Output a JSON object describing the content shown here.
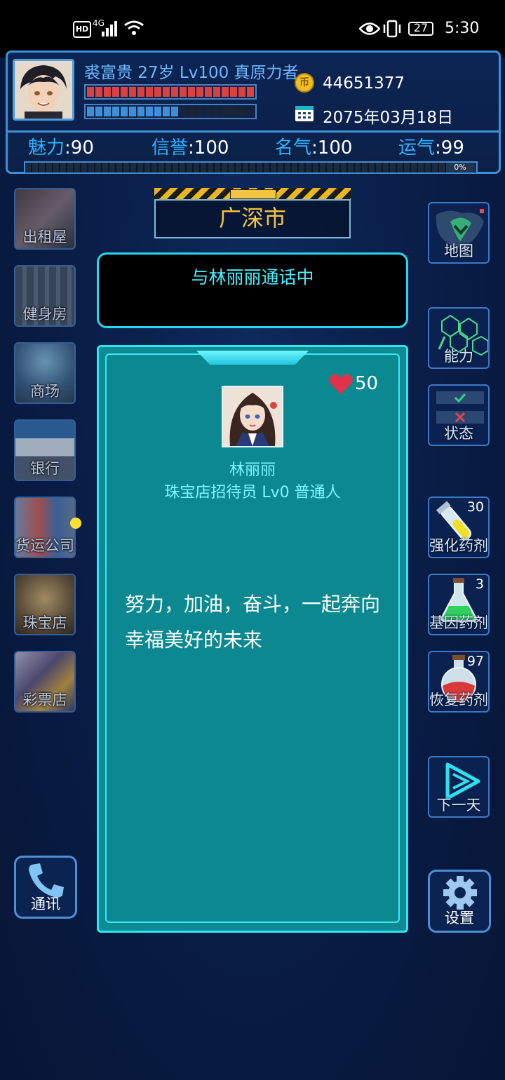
{
  "status_bar": {
    "hd": "HD",
    "net": "4G",
    "battery": "27",
    "time": "5:30"
  },
  "player": {
    "info": "裘富贵 27岁 Lv100 真原力者",
    "coins": "44651377",
    "date": "2075年03月18日",
    "hp_fill": 1.0,
    "mp_fill": 0.55,
    "exp_percent": "0%",
    "colors": {
      "hp": "#d9423f",
      "mp": "#3f8fd6",
      "label": "#31b3ff"
    }
  },
  "stats": [
    {
      "label": "魅力",
      "value": "90"
    },
    {
      "label": "信誉",
      "value": "100"
    },
    {
      "label": "名气",
      "value": "100"
    },
    {
      "label": "运气",
      "value": "99"
    }
  ],
  "left_nav": [
    {
      "label": "出租屋"
    },
    {
      "label": "健身房"
    },
    {
      "label": "商场"
    },
    {
      "label": "银行"
    },
    {
      "label": "货运公司"
    },
    {
      "label": "珠宝店"
    },
    {
      "label": "彩票店"
    }
  ],
  "city": "广深市",
  "call_status": "与林丽丽通话中",
  "npc": {
    "name": "林丽丽",
    "role": "珠宝店招待员 Lv0 普通人",
    "affection": "50",
    "message": "努力，加油，奋斗，一起奔向幸福美好的未来"
  },
  "right_nav": {
    "map": "地图",
    "ability": "能力",
    "status": "状态",
    "potion_enhance": {
      "label": "强化药剂",
      "count": "30"
    },
    "potion_gene": {
      "label": "基因药剂",
      "count": "3"
    },
    "potion_recover": {
      "label": "恢复药剂",
      "count": "97"
    },
    "next_day": "下一天",
    "settings": "设置"
  },
  "comm_label": "通讯"
}
